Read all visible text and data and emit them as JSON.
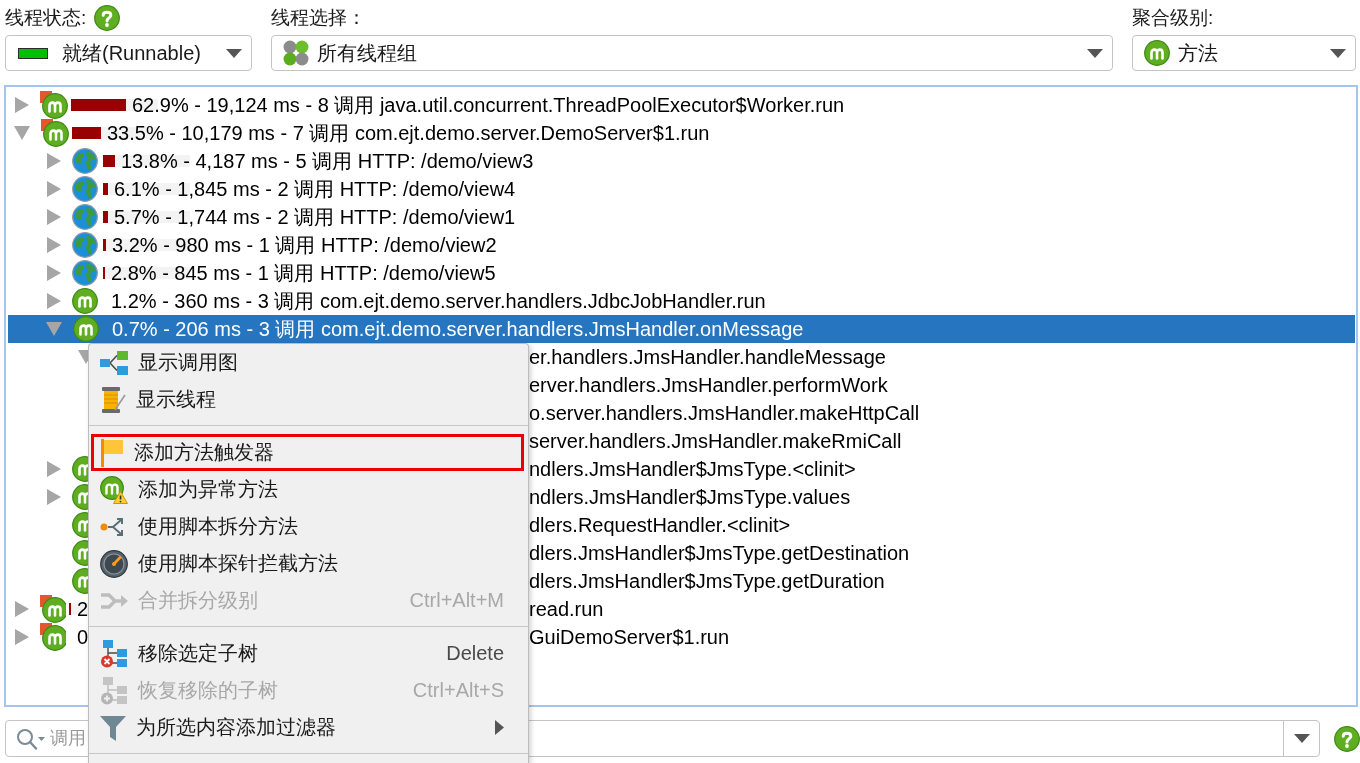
{
  "toolbar": {
    "thread_state": {
      "label": "线程状态:",
      "value": "就绪(Runnable)"
    },
    "thread_selection": {
      "label": "线程选择：",
      "value": "所有线程组"
    },
    "aggregation": {
      "label": "聚合级别:",
      "value": "方法"
    }
  },
  "tree": {
    "rows": [
      {
        "expanded": false,
        "kind": "thread",
        "level": 0.629,
        "text": "62.9% - 19,124 ms - 8 调用 java.util.concurrent.ThreadPoolExecutor$Worker.run",
        "selected": false
      },
      {
        "expanded": true,
        "kind": "thread",
        "level": 0.335,
        "text": "33.5% - 10,179 ms - 7 调用 com.ejt.demo.server.DemoServer$1.run",
        "selected": false,
        "children": [
          {
            "expanded": false,
            "kind": "request",
            "level": 0.138,
            "text": "13.8% - 4,187 ms - 5 调用 HTTP: /demo/view3",
            "selected": false
          },
          {
            "expanded": false,
            "kind": "request",
            "level": 0.061,
            "text": "6.1% - 1,845 ms - 2 调用 HTTP: /demo/view4",
            "selected": false
          },
          {
            "expanded": false,
            "kind": "request",
            "level": 0.057,
            "text": "5.7% - 1,744 ms - 2 调用 HTTP: /demo/view1",
            "selected": false
          },
          {
            "expanded": false,
            "kind": "request",
            "level": 0.032,
            "text": "3.2% - 980 ms - 1 调用 HTTP: /demo/view2",
            "selected": false
          },
          {
            "expanded": false,
            "kind": "request",
            "level": 0.028,
            "text": "2.8% - 845 ms - 1 调用 HTTP: /demo/view5",
            "selected": false
          },
          {
            "expanded": false,
            "kind": "method",
            "text": "1.2% - 360 ms - 3 调用 com.ejt.demo.server.handlers.JdbcJobHandler.run",
            "selected": false
          },
          {
            "expanded": true,
            "kind": "method",
            "text": "0.7% - 206 ms - 3 调用 com.ejt.demo.server.handlers.JmsHandler.onMessage",
            "selected": true,
            "children": [
              {
                "expanded": true,
                "tail": "er.handlers.JmsHandler.handleMessage",
                "selected": false,
                "children": [
                  {
                    "tail": "erver.handlers.JmsHandler.performWork",
                    "selected": false
                  },
                  {
                    "tail": "o.server.handlers.JmsHandler.makeHttpCall",
                    "selected": false
                  },
                  {
                    "tail": "server.handlers.JmsHandler.makeRmiCall",
                    "selected": false
                  }
                ]
              }
            ]
          },
          {
            "expanded": false,
            "kind": "method",
            "tail": "ndlers.JmsHandler$JmsType.<clinit>",
            "selected": false
          },
          {
            "expanded": false,
            "kind": "method",
            "tail": "ndlers.JmsHandler$JmsType.values",
            "selected": false
          },
          {
            "kind": "method",
            "tail": "dlers.RequestHandler.<clinit>",
            "selected": false
          },
          {
            "kind": "method",
            "tail": "dlers.JmsHandler$JmsType.getDestination",
            "selected": false
          },
          {
            "kind": "method",
            "tail": "dlers.JmsHandler$JmsType.getDuration",
            "selected": false
          }
        ]
      },
      {
        "expanded": false,
        "kind": "thread",
        "level": 0.02,
        "text": "2",
        "tail": "read.run",
        "selected": false
      },
      {
        "expanded": false,
        "kind": "thread",
        "text": "0",
        "tail": "GuiDemoServer$1.run",
        "selected": false
      }
    ]
  },
  "context_menu": {
    "items": [
      {
        "kind": "item",
        "label": "显示调用图",
        "disabled": false,
        "highlighted": false,
        "submenu": false
      },
      {
        "kind": "item",
        "label": "显示线程",
        "disabled": false,
        "highlighted": false,
        "submenu": false
      },
      {
        "kind": "separator"
      },
      {
        "kind": "item",
        "label": "添加方法触发器",
        "disabled": false,
        "highlighted": true,
        "submenu": false
      },
      {
        "kind": "item",
        "label": "添加为异常方法",
        "disabled": false,
        "highlighted": false,
        "submenu": false
      },
      {
        "kind": "item",
        "label": "使用脚本拆分方法",
        "disabled": false,
        "highlighted": false,
        "submenu": false
      },
      {
        "kind": "item",
        "label": "使用脚本探针拦截方法",
        "disabled": false,
        "highlighted": false,
        "submenu": false
      },
      {
        "kind": "item",
        "label": "合并拆分级别",
        "shortcut": "Ctrl+Alt+M",
        "disabled": true,
        "highlighted": false,
        "submenu": false
      },
      {
        "kind": "separator"
      },
      {
        "kind": "item",
        "label": "移除选定子树",
        "shortcut": "Delete",
        "disabled": false,
        "highlighted": false,
        "submenu": false
      },
      {
        "kind": "item",
        "label": "恢复移除的子树",
        "shortcut": "Ctrl+Alt+S",
        "disabled": true,
        "highlighted": false,
        "submenu": false
      },
      {
        "kind": "item",
        "label": "为所选内容添加过滤器",
        "disabled": false,
        "highlighted": false,
        "submenu": true
      },
      {
        "kind": "separator"
      }
    ]
  },
  "search": {
    "placeholder": "调用"
  }
}
